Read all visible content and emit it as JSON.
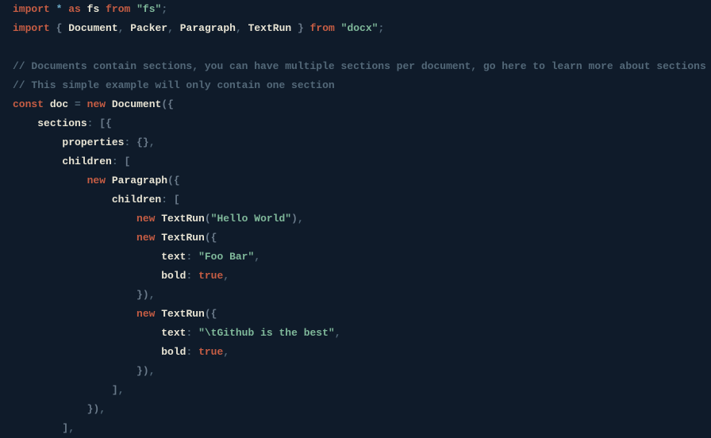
{
  "code": {
    "kw_import": "import",
    "kw_as": "as",
    "kw_from": "from",
    "kw_const": "const",
    "kw_new": "new",
    "star": "*",
    "fs_alias": "fs",
    "fs_module": "\"fs\"",
    "semi": ";",
    "brace_open": "{",
    "brace_close": "}",
    "paren_open": "(",
    "paren_close": ")",
    "bracket_open": "[",
    "bracket_close": "]",
    "comma": ",",
    "colon": ":",
    "equals": "=",
    "import_Document": "Document",
    "import_Packer": "Packer",
    "import_Paragraph": "Paragraph",
    "import_TextRun": "TextRun",
    "docx_module": "\"docx\"",
    "comment1": "// Documents contain sections, you can have multiple sections per document, go here to learn more about sections",
    "comment2": "// This simple example will only contain one section",
    "var_doc": "doc",
    "class_Document": "Document",
    "prop_sections": "sections",
    "prop_properties": "properties",
    "prop_children": "children",
    "class_Paragraph": "Paragraph",
    "class_TextRun": "TextRun",
    "str_hello": "\"Hello World\"",
    "prop_text": "text",
    "prop_bold": "bold",
    "str_foobar": "\"Foo Bar\"",
    "str_github": "\"\\tGithub is the best\"",
    "val_true": "true"
  }
}
